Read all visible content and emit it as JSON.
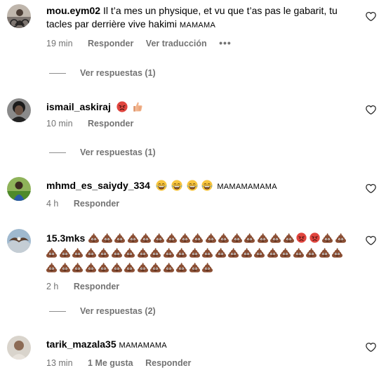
{
  "comments": [
    {
      "username": "mou.eym02",
      "text": "Il t’a mes un physique, et vu que t’as pas le gabarit, tu tacles par derrière vive hakimi",
      "tail": "MAMAMA",
      "time": "19 min",
      "reply_label": "Responder",
      "translate_label": "Ver traducción",
      "more_label": "•••",
      "view_replies": "Ver respuestas (1)",
      "avatar": "person-on-bike-photo"
    },
    {
      "username": "ismail_askiraj",
      "emojis": [
        "angry-face",
        "thumbs-up"
      ],
      "time": "10 min",
      "reply_label": "Responder",
      "view_replies": "Ver respuestas (1)",
      "avatar": "dark-hair-photo"
    },
    {
      "username": "mhmd_es_saiydy_334",
      "emojis": [
        "laughing-face",
        "laughing-face",
        "laughing-face",
        "laughing-face"
      ],
      "tail": "MAMAMAMAMA",
      "time": "4 h",
      "reply_label": "Responder",
      "avatar": "person-in-field-photo"
    },
    {
      "username": "15.3mks",
      "emoji_note": "pile-of-poo repeated with two angry faces",
      "time": "2 h",
      "reply_label": "Responder",
      "view_replies": "Ver respuestas (2)",
      "avatar": "bird-flying-photo"
    },
    {
      "username": "tarik_mazala35",
      "tail": "MAMAMAMA",
      "time": "13 min",
      "likes_label": "1 Me gusta",
      "reply_label": "Responder",
      "avatar": "portrait-photo"
    }
  ],
  "colors": {
    "text": "#000000",
    "meta": "#737373",
    "background": "#ffffff"
  },
  "icons": {
    "like": "heart-outline-icon"
  }
}
